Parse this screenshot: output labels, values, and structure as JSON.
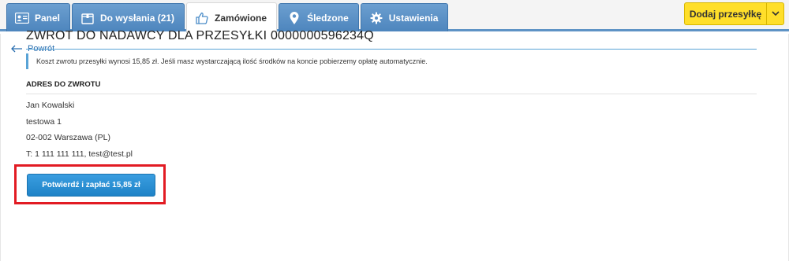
{
  "tabs": [
    {
      "label": "Panel",
      "icon": "id-card-icon"
    },
    {
      "label": "Do wysłania (21)",
      "icon": "package-icon"
    },
    {
      "label": "Zamówione",
      "icon": "thumbs-up-icon",
      "active": true
    },
    {
      "label": "Śledzone",
      "icon": "map-pin-icon"
    },
    {
      "label": "Ustawienia",
      "icon": "gear-icon"
    }
  ],
  "add_button": {
    "label": "Dodaj przesyłkę",
    "icon": "chevron-down-icon"
  },
  "back_link": {
    "label": "Powrót"
  },
  "page_title": "ZWROT DO NADAWCY DLA PRZESYŁKI 0000000596234Q",
  "info_text": "Koszt zwrotu przesyłki wynosi 15,85 zł. Jeśli masz wystarczającą ilość środków na koncie pobierzemy opłatę automatycznie.",
  "section": {
    "title": "ADRES DO ZWROTU"
  },
  "address": {
    "name": "Jan Kowalski",
    "street": "testowa 1",
    "city": "02-002 Warszawa (PL)",
    "contact": "T: 1 111 111 111, test@test.pl"
  },
  "confirm_button": {
    "label": "Potwierdź i zapłać 15,85 zł"
  },
  "colors": {
    "tab_blue": "#4d85bd",
    "accent": "#59a3d6",
    "add_yellow": "#ffdf2a",
    "confirm_blue": "#1f83c7",
    "highlight_red": "#e21b23"
  }
}
